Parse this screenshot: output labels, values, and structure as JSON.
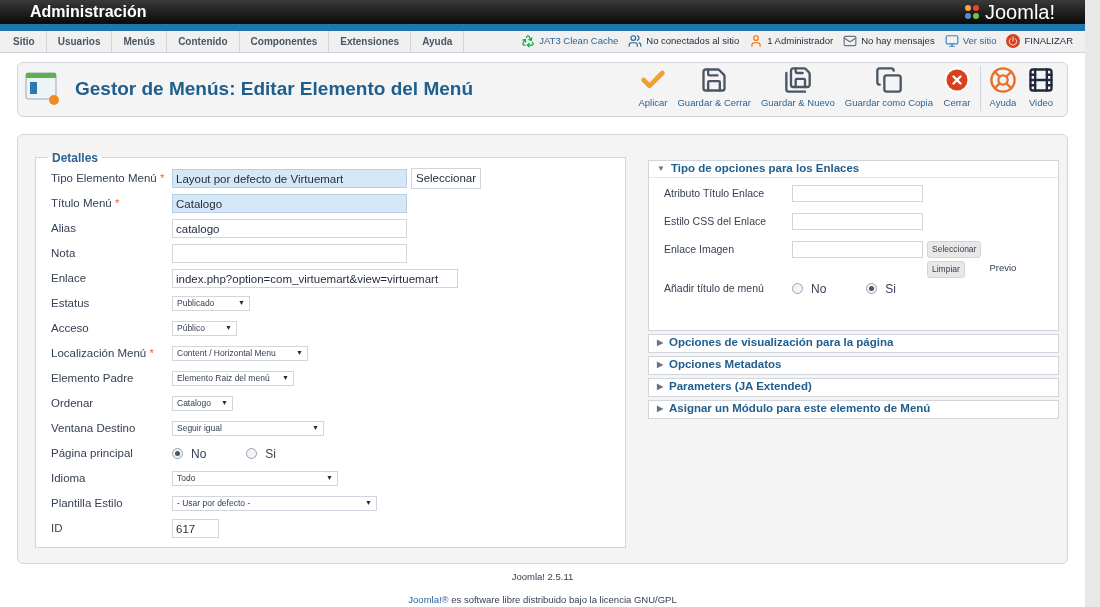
{
  "header": {
    "title": "Administración",
    "logo_text": "Joomla!"
  },
  "menu": {
    "items": [
      "Sitio",
      "Usuarios",
      "Menús",
      "Contenido",
      "Componentes",
      "Extensiones",
      "Ayuda"
    ]
  },
  "status": [
    {
      "kind": "cache",
      "label": "JAT3 Clean Cache"
    },
    {
      "kind": "visitors",
      "label": "No conectados al sitio"
    },
    {
      "kind": "admins",
      "label": "1 Administrador"
    },
    {
      "kind": "messages",
      "label": "No hay mensajes"
    },
    {
      "kind": "site",
      "label": "Ver sitio"
    },
    {
      "kind": "logout",
      "label": "FINALIZAR"
    }
  ],
  "toolbar": {
    "title": "Gestor de Menús: Editar Elemento del Menú",
    "buttons": [
      {
        "kind": "apply",
        "label": "Aplicar"
      },
      {
        "kind": "save",
        "label": "Guardar & Cerrar"
      },
      {
        "kind": "save_new",
        "label": "Guardar & Nuevo"
      },
      {
        "kind": "save_copy",
        "label": "Guardar como Copia"
      },
      {
        "kind": "close",
        "label": "Cerrar"
      },
      {
        "kind": "help",
        "label": "Ayuda"
      },
      {
        "kind": "video",
        "label": "Video"
      }
    ]
  },
  "details": {
    "legend": "Detalles",
    "fields": [
      {
        "kind": "text",
        "label": "Tipo Elemento Menú",
        "required_mark": "*",
        "value": "Layout por defecto de Virtuemart",
        "highlighted": true,
        "button": "Seleccionar"
      },
      {
        "kind": "text",
        "label": "Título Menú",
        "required_mark": "*",
        "value": "Catalogo",
        "highlighted": true
      },
      {
        "kind": "text",
        "label": "Alias",
        "value": "catalogo",
        "highlighted": false
      },
      {
        "kind": "text",
        "label": "Nota",
        "highlighted": false
      },
      {
        "kind": "link",
        "label": "Enlace",
        "value": "index.php?option=com_virtuemart&view=virtuemart"
      },
      {
        "kind": "select",
        "label": "Estatus",
        "value": "Publicado",
        "caret": "▼"
      },
      {
        "kind": "select",
        "label": "Acceso",
        "value": "Público",
        "caret": "▼"
      },
      {
        "kind": "select",
        "label": "Localización Menú",
        "required_mark": "*",
        "value": "Content / Horizontal Menu",
        "caret": "▼"
      },
      {
        "kind": "select",
        "label": "Elemento Padre",
        "value": "Elemento Raiz del menú",
        "caret": "▼"
      },
      {
        "kind": "select",
        "label": "Ordenar",
        "value": "Catalogo",
        "caret": "▼"
      },
      {
        "kind": "select",
        "label": "Ventana Destino",
        "value": "Seguir igual",
        "caret": "▼"
      },
      {
        "kind": "radio",
        "label": "Página principal",
        "options": [
          {
            "label": "No",
            "selected": true
          },
          {
            "label": "Si",
            "selected": false
          }
        ]
      },
      {
        "kind": "select",
        "label": "Idioma",
        "value": "Todo",
        "caret": "▼"
      },
      {
        "kind": "select",
        "label": "Plantilla Estilo",
        "value": "- Usar por defecto -",
        "caret": "▼"
      },
      {
        "kind": "id",
        "label": "ID",
        "value": "617"
      }
    ]
  },
  "panels": [
    {
      "title": "Tipo de opciones para los Enlaces",
      "arrow": "▼",
      "expanded": true,
      "fields": [
        {
          "kind": "text",
          "label": "Atributo Título Enlace"
        },
        {
          "kind": "text",
          "label": "Estilo CSS del Enlace"
        },
        {
          "kind": "image",
          "label": "Enlace Imagen",
          "buttons": [
            "Seleccionar",
            "Limpiar"
          ],
          "preview": "Previo"
        },
        {
          "kind": "radio",
          "label": "Añadir título de menú",
          "options": [
            {
              "label": "No",
              "selected": false
            },
            {
              "label": "Si",
              "selected": true
            }
          ]
        }
      ]
    },
    {
      "title": "Opciones de visualización para la página",
      "arrow": "▶",
      "expanded": false
    },
    {
      "title": "Opciones Metadatos",
      "arrow": "▶",
      "expanded": false
    },
    {
      "title": "Parameters (JA Extended)",
      "arrow": "▶",
      "expanded": false
    },
    {
      "title": "Asignar un Módulo para este elemento de Menú",
      "arrow": "▶",
      "expanded": false
    }
  ],
  "footer": {
    "version": "Joomla! 2.5.11",
    "link": "Joomla!®",
    "license_rest": "es software libre distribuido bajo la licencia GNU/GPL"
  }
}
